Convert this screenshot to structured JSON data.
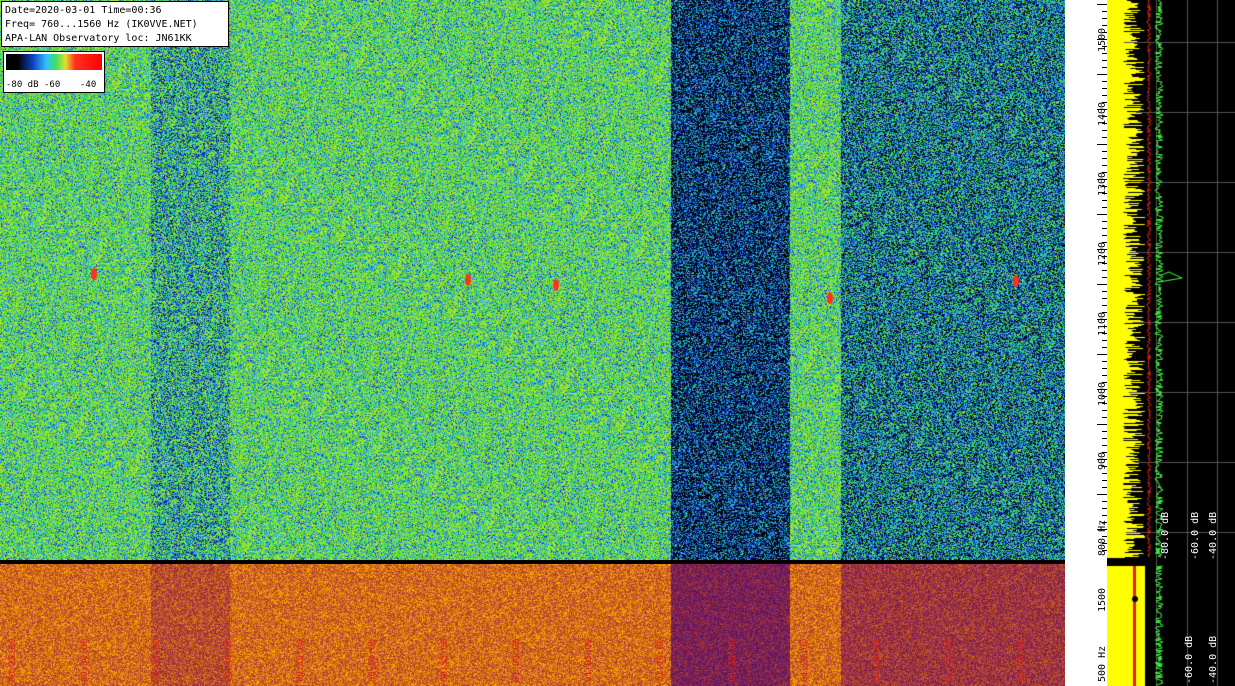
{
  "info": {
    "line1": "Date=2020-03-01 Time=00:36",
    "line2": "Freq= 760...1560 Hz (IK0VVE.NET)",
    "line3": "APA-LAN Observatory loc: JN61KK"
  },
  "colorbar": {
    "label_a": "-80 dB",
    "label_b": "-60",
    "label_c": "-40"
  },
  "freq_axis": {
    "ticks": [
      "1500",
      "1400",
      "1300",
      "1200",
      "1100",
      "1000",
      "900",
      "800 Hz"
    ]
  },
  "lower_axis": {
    "ticks": [
      "1500",
      "500 Hz"
    ]
  },
  "time_labels": [
    "00:25:00",
    "00:30:00",
    "00:35:00",
    "00:40:00",
    "00:45:00",
    "00:50:00",
    "00:55:00",
    "01:00:00",
    "01:05:00",
    "01:10:00",
    "01:15:00",
    "01:20:00",
    "01:25:00",
    "01:30:00",
    "01:35:00"
  ],
  "spectrum_labels": {
    "upper_a": "-60.0 dB",
    "upper_b": "-40.0 dB",
    "upper_c": "-80.0 dB",
    "lower_a": "-60.0 dB",
    "lower_b": "-40.0 dB"
  },
  "colors": {
    "upper_bg": "#0a2a6a",
    "lower_bg": "#c07010",
    "trace": "#ffff00",
    "trace2": "#40ff40"
  }
}
